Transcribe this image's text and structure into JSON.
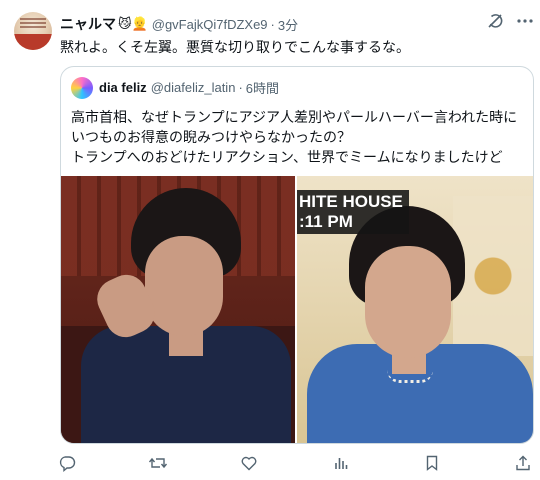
{
  "tweet": {
    "author_name": "ニャルマ",
    "author_emojis": "😼👱",
    "handle": "@gvFajkQi7fDZXe9",
    "separator": "·",
    "time": "3分",
    "text": "黙れよ。くそ左翼。悪質な切り取りでこんな事するな。"
  },
  "quote": {
    "author_name": "dia feliz",
    "handle": "@diafeliz_latin",
    "separator": "·",
    "time": "6時間",
    "text_lines": [
      "高市首相、なぜトランプにアジア人差別やパールハーバー言われた時に",
      "いつものお得意の睨みつけやらなかったの？",
      "トランプへのおどけたリアクション、世界でミームになりましたけど"
    ],
    "right_image_caption_lines": [
      "HITE HOUSE",
      ":11 PM"
    ]
  },
  "icons": {
    "header": [
      "grok-icon",
      "more-icon"
    ],
    "actions": [
      "reply-icon",
      "retweet-icon",
      "like-icon",
      "views-icon",
      "bookmark-icon",
      "share-icon"
    ]
  },
  "colors": {
    "secondary_text": "#536471",
    "border": "#cfd9de"
  }
}
